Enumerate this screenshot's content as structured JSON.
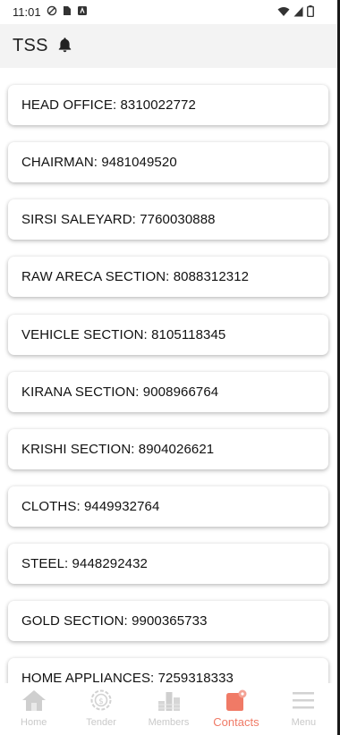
{
  "status_bar": {
    "time": "11:01"
  },
  "app_bar": {
    "title": "TSS"
  },
  "contacts": [
    {
      "label": "HEAD OFFICE: 8310022772"
    },
    {
      "label": "CHAIRMAN: 9481049520"
    },
    {
      "label": "SIRSI SALEYARD: 7760030888"
    },
    {
      "label": "RAW ARECA SECTION: 8088312312"
    },
    {
      "label": "VEHICLE SECTION: 8105118345"
    },
    {
      "label": "KIRANA SECTION: 9008966764"
    },
    {
      "label": "KRISHI SECTION: 8904026621"
    },
    {
      "label": "CLOTHS: 9449932764"
    },
    {
      "label": "STEEL: 9448292432"
    },
    {
      "label": "GOLD SECTION: 9900365733"
    },
    {
      "label": "HOME APPLIANCES: 7259318333"
    }
  ],
  "bottom_nav": {
    "items": [
      {
        "label": "Home",
        "icon": "home-icon"
      },
      {
        "label": "Tender",
        "icon": "tender-icon"
      },
      {
        "label": "Members",
        "icon": "members-icon"
      },
      {
        "label": "Contacts",
        "icon": "contacts-icon"
      },
      {
        "label": "Menu",
        "icon": "menu-icon"
      }
    ],
    "active": "Contacts"
  },
  "colors": {
    "accent": "#f07a66",
    "inactive": "#c9c9c9",
    "appbar_bg": "#f3f3f3"
  }
}
